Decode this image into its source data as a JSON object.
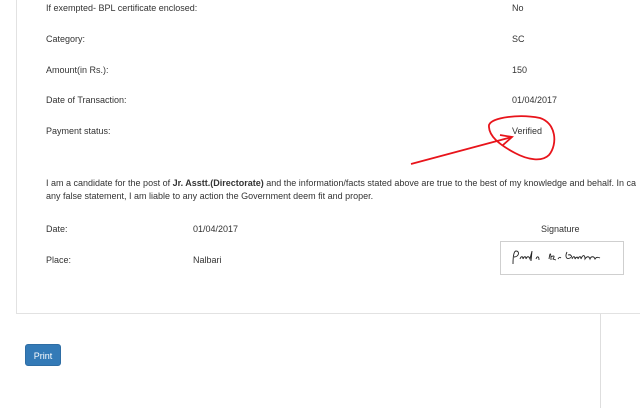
{
  "details": [
    {
      "label": "If exempted- BPL certificate enclosed:",
      "value": "No"
    },
    {
      "label": "Category:",
      "value": "SC"
    },
    {
      "label": "Amount(in Rs.):",
      "value": "150"
    },
    {
      "label": "Date of Transaction:",
      "value": "01/04/2017"
    },
    {
      "label": "Payment status:",
      "value": "Verified"
    }
  ],
  "declaration": {
    "prefix": "I am a candidate for the post of ",
    "post": "Jr. Asstt.(Directorate)",
    "suffix": " and the information/facts stated above are true to the best of my knowledge and behalf. In ca",
    "line2": "any false statement, I am liable to any action the Government deem fit and proper."
  },
  "footer": {
    "date_label": "Date:",
    "date_value": "01/04/2017",
    "place_label": "Place:",
    "place_value": "Nalbari",
    "signature_label": "Signature",
    "signature_text": "Pradip kr. Barishya"
  },
  "print_label": "Print",
  "annotation": {
    "color": "#e8141b"
  }
}
